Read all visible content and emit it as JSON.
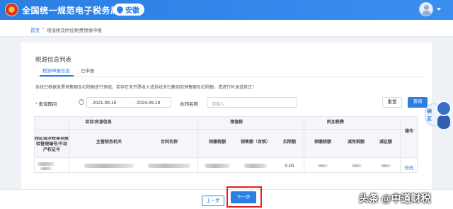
{
  "header": {
    "site_title": "全国统一规范电子税务局",
    "region": "安徽"
  },
  "breadcrumb": {
    "home": "首页",
    "separator": ">",
    "current": "增值税及附加税费预缴申报"
  },
  "card": {
    "title": "税源信息列表",
    "tabs": [
      "税源申报信息",
      "已申报"
    ],
    "notice": "系统已根据发票销售额及扣除额进行预填，若存在未开票收入或系统未归集到的销售额及扣除额，请进行补录或修正！"
  },
  "filter": {
    "required_mark": "*",
    "period_label": "查询期间",
    "date_from": "2021-09-19",
    "date_separator": "-",
    "date_to": "2024-09-19",
    "contract_label": "合同名称",
    "contract_placeholder": "请输入",
    "reset_label": "重置",
    "query_label": "查询"
  },
  "table": {
    "group_project": "项目/房源信息",
    "group_vat": "增值税",
    "group_surcharge": "附加税费",
    "col_tax_source": "跨区域涉税事项报验管理编号/不动产权证号",
    "col_tax_authority": "主管税务机关",
    "col_contract": "合同名称",
    "col_prepaid_tax": "预缴税额",
    "col_sales": "销售额（含税）",
    "col_deduction": "扣除额",
    "col_prepaid_tax_2": "预缴税额",
    "col_reduction": "减免税额",
    "col_collected": "减征额",
    "col_action": "操作",
    "rows": [
      {
        "deduction": "0.00",
        "action": "修改"
      }
    ]
  },
  "footer": {
    "prev_label": "上一步",
    "next_label": "下一步"
  },
  "assistant": {
    "line1": "纳",
    "line2": "互"
  },
  "watermark": "头条 @中道财税",
  "colors": {
    "primary": "#2b7fe3",
    "highlight_border": "#e02020"
  }
}
